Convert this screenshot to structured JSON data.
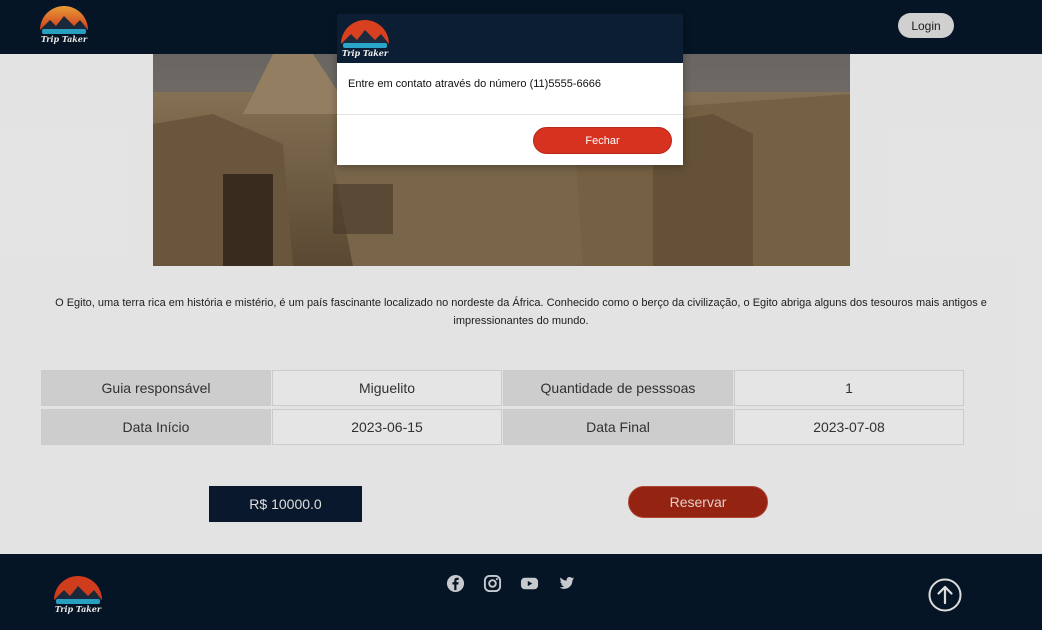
{
  "header": {
    "login_label": "Login",
    "logo_icon": "trip-taker-logo",
    "logo_text": "Trip Taker"
  },
  "destination": {
    "description": "O Egito, uma terra rica em história e mistério, é um país fascinante localizado no nordeste da África. Conhecido como o berço da civilização, o Egito abriga alguns dos tesouros mais antigos e impressionantes do mundo."
  },
  "info": {
    "guide_label": "Guia responsável",
    "guide_value": "Miguelito",
    "people_label": "Quantidade de pesssoas",
    "people_value": "1",
    "start_label": "Data Início",
    "start_value": "2023-06-15",
    "end_label": "Data Final",
    "end_value": "2023-07-08"
  },
  "price": "R$ 10000.0",
  "reserve_label": "Reservar",
  "modal": {
    "message": "Entre em contato através do número (11)5555-6666",
    "close_label": "Fechar"
  },
  "footer": {
    "social_icons": [
      "facebook-icon",
      "instagram-icon",
      "youtube-icon",
      "twitter-icon"
    ],
    "back_to_top_icon": "arrow-up-circle-icon"
  },
  "colors": {
    "navy": "#071627",
    "red": "#d6321f",
    "dark_red": "#9b2513"
  }
}
